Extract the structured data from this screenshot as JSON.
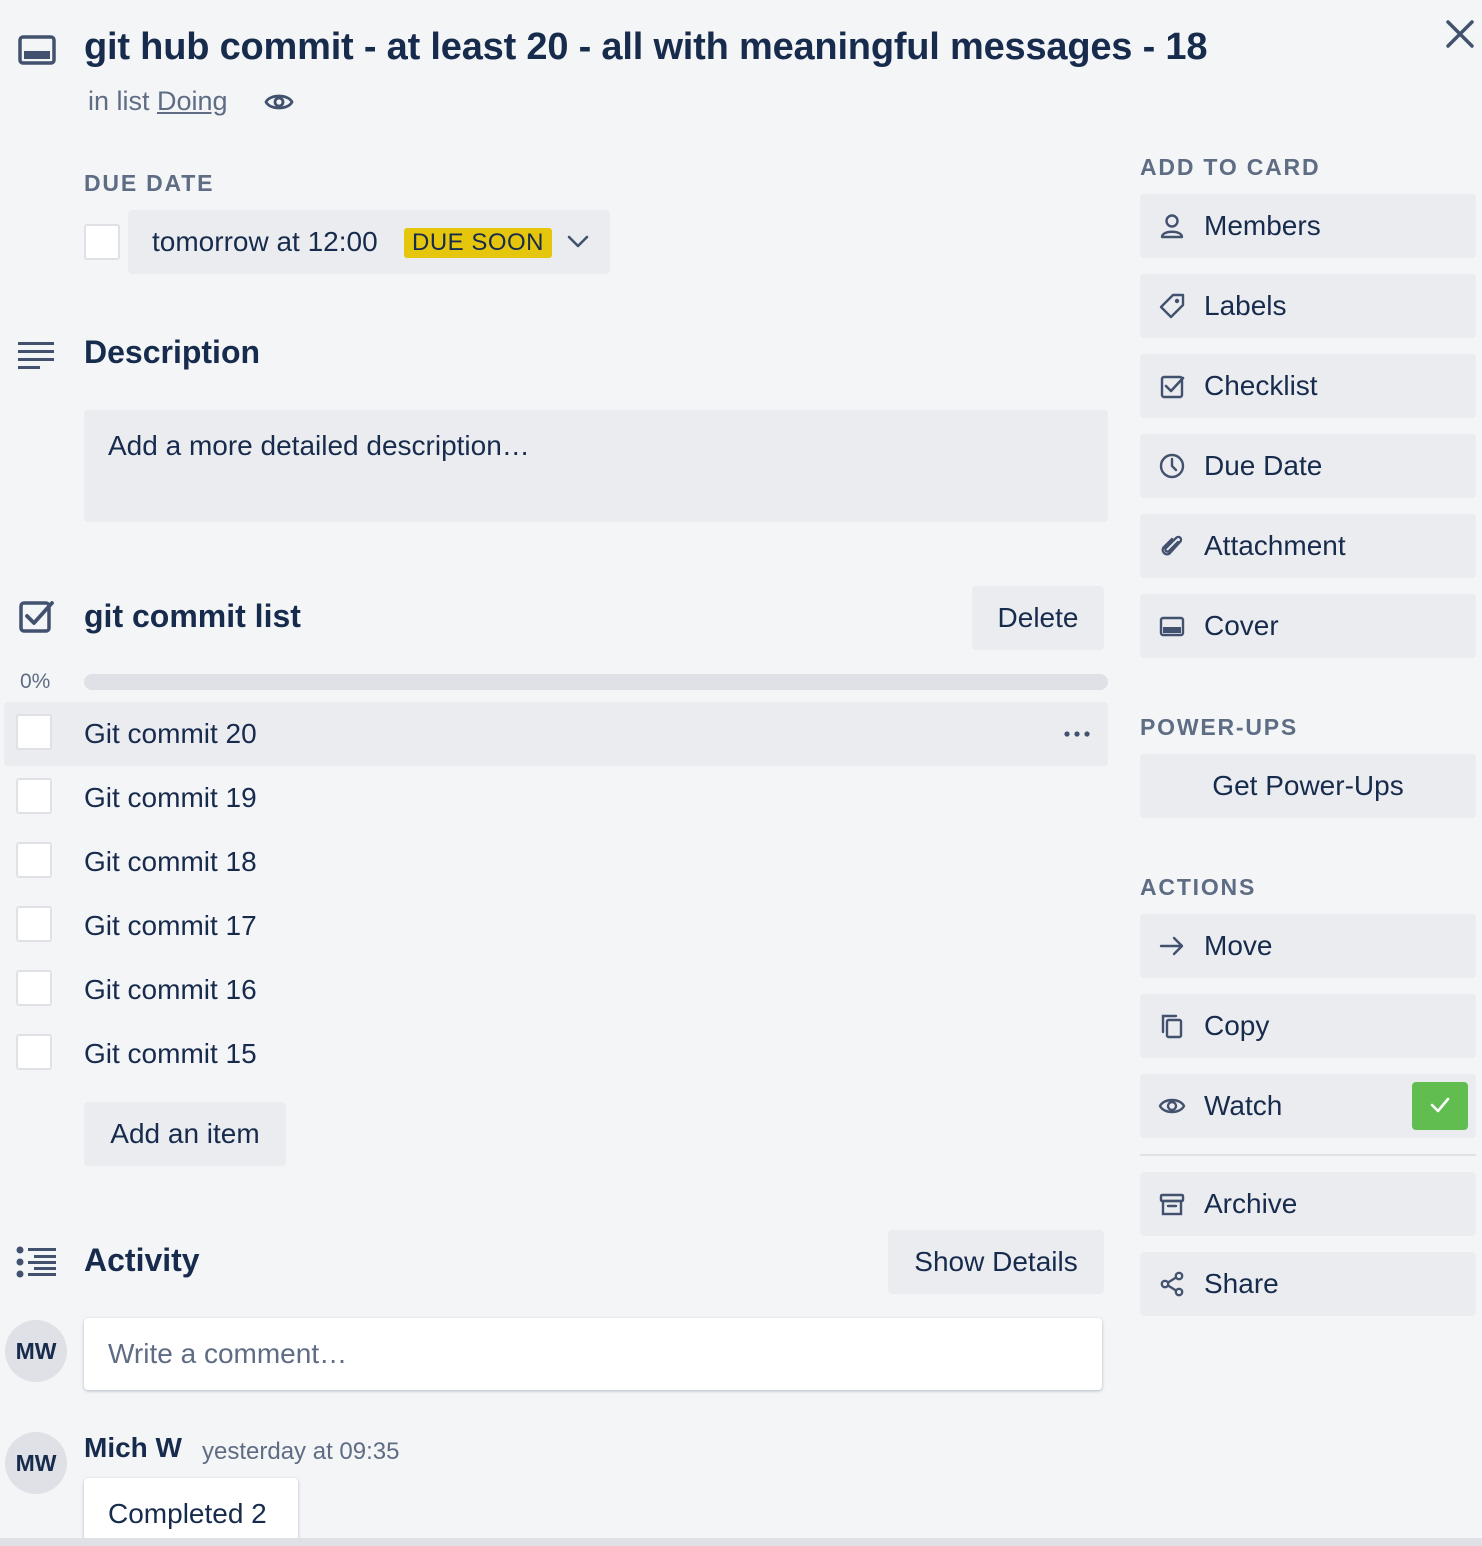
{
  "card": {
    "title": "git hub commit - at least 20 - all with meaningful messages - 18",
    "in_list_prefix": "in list",
    "list_name": "Doing"
  },
  "due_date": {
    "label": "DUE DATE",
    "value": "tomorrow at 12:00",
    "badge": "DUE SOON",
    "badge_color": "#e6c60d",
    "completed": false
  },
  "description": {
    "title": "Description",
    "placeholder": "Add a more detailed description…"
  },
  "checklist": {
    "title": "git commit list",
    "delete_label": "Delete",
    "progress_text": "0%",
    "progress": 0,
    "items": [
      {
        "label": "Git commit 20",
        "checked": false
      },
      {
        "label": "Git commit 19",
        "checked": false
      },
      {
        "label": "Git commit 18",
        "checked": false
      },
      {
        "label": "Git commit 17",
        "checked": false
      },
      {
        "label": "Git commit 16",
        "checked": false
      },
      {
        "label": "Git commit 15",
        "checked": false
      }
    ],
    "add_item_label": "Add an item"
  },
  "activity": {
    "title": "Activity",
    "show_details_label": "Show Details",
    "comment_placeholder": "Write a comment…",
    "current_user_initials": "MW",
    "entries": [
      {
        "initials": "MW",
        "author": "Mich W",
        "timestamp": "yesterday at 09:35",
        "text": "Completed 2"
      }
    ]
  },
  "sidebar": {
    "add_to_card_label": "ADD TO CARD",
    "add_to_card": [
      {
        "label": "Members",
        "icon": "person-icon"
      },
      {
        "label": "Labels",
        "icon": "tag-icon"
      },
      {
        "label": "Checklist",
        "icon": "checkbox-icon"
      },
      {
        "label": "Due Date",
        "icon": "clock-icon"
      },
      {
        "label": "Attachment",
        "icon": "paperclip-icon"
      },
      {
        "label": "Cover",
        "icon": "cover-icon"
      }
    ],
    "power_ups_label": "POWER-UPS",
    "get_power_ups_label": "Get Power-Ups",
    "actions_label": "ACTIONS",
    "actions": [
      {
        "label": "Move",
        "icon": "arrow-right-icon"
      },
      {
        "label": "Copy",
        "icon": "copy-icon"
      },
      {
        "label": "Watch",
        "icon": "eye-icon",
        "active": true
      },
      {
        "label": "Archive",
        "icon": "archive-icon"
      },
      {
        "label": "Share",
        "icon": "share-icon"
      }
    ]
  },
  "colors": {
    "background": "#f4f5f7",
    "button_bg": "#ebecf0",
    "text": "#172b4d",
    "muted_text": "#5e6c84",
    "watch_active": "#61bd4f"
  }
}
